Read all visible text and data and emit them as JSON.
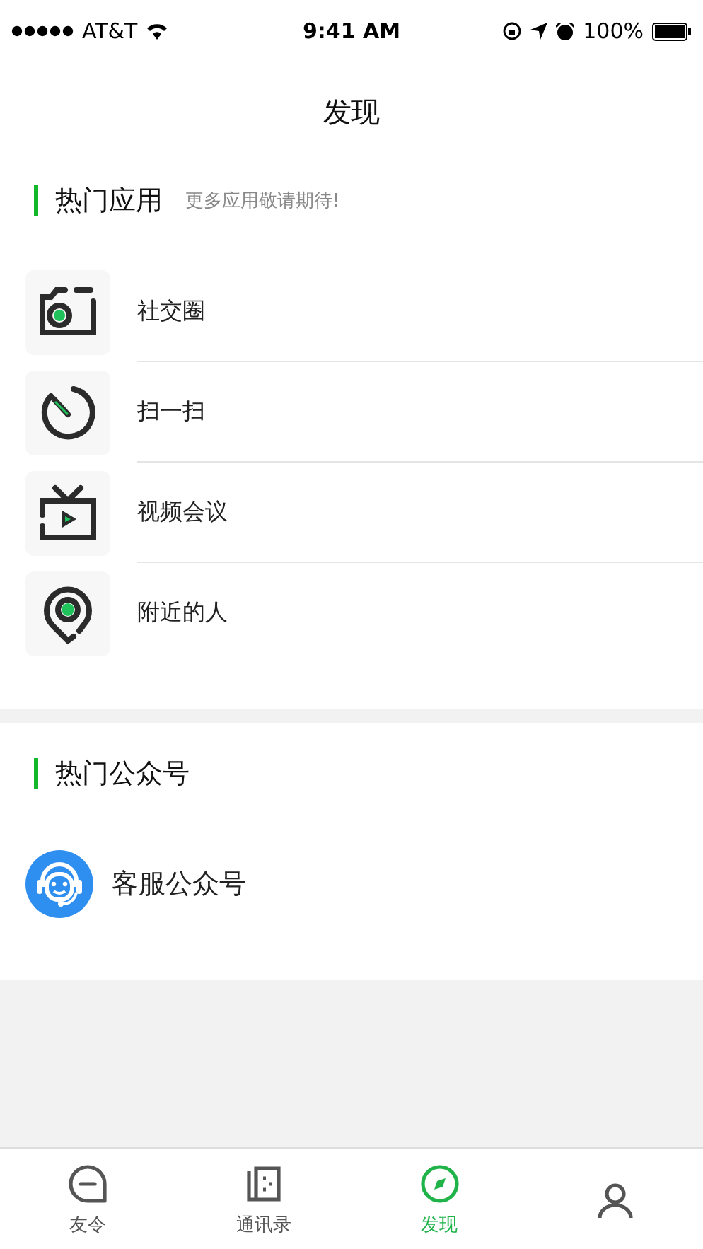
{
  "status_bar": {
    "carrier": "AT&T",
    "time": "9:41 AM",
    "battery": "100%"
  },
  "title": "发现",
  "apps_section": {
    "title": "热门应用",
    "subtitle": "更多应用敬请期待!",
    "items": [
      {
        "kind": "camera",
        "label": "社交圈"
      },
      {
        "kind": "scan",
        "label": "扫一扫"
      },
      {
        "kind": "tv",
        "label": "视频会议"
      },
      {
        "kind": "pin",
        "label": "附近的人"
      }
    ]
  },
  "accounts_section": {
    "title": "热门公众号",
    "items": [
      {
        "kind": "support",
        "label": "客服公众号"
      }
    ]
  },
  "tab_bar": [
    {
      "kind": "chat",
      "label": "友令",
      "selected": false
    },
    {
      "kind": "contacts",
      "label": "通讯录",
      "selected": false
    },
    {
      "kind": "discover",
      "label": "发现",
      "selected": true
    },
    {
      "kind": "me",
      "selected": false
    }
  ]
}
